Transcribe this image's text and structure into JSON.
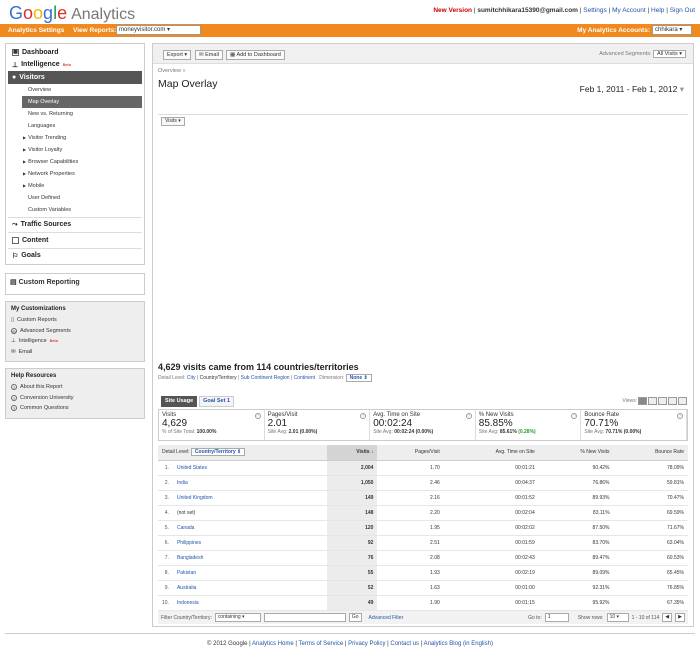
{
  "header": {
    "logo_google": [
      "G",
      "o",
      "o",
      "g",
      "l",
      "e"
    ],
    "logo_analytics": "Analytics",
    "new_version": "New Version",
    "user_email": "sumitchhikara15390@gmail.com",
    "links": [
      "Settings",
      "My Account",
      "Help",
      "Sign Out"
    ]
  },
  "orange_bar": {
    "analytics_settings": "Analytics Settings",
    "view_reports": "View Reports:",
    "site": "moneyvisitor.com",
    "my_accounts": "My Analytics Accounts:",
    "account": "chhikara"
  },
  "sidebar": {
    "dashboard": "Dashboard",
    "intelligence": "Intelligence",
    "beta": "Beta",
    "visitors": "Visitors",
    "visitor_items": [
      {
        "label": "Overview",
        "arrow": false
      },
      {
        "label": "Map Overlay",
        "arrow": false,
        "active": true
      },
      {
        "label": "New vs. Returning",
        "arrow": false
      },
      {
        "label": "Languages",
        "arrow": false
      },
      {
        "label": "Visitor Trending",
        "arrow": true
      },
      {
        "label": "Visitor Loyalty",
        "arrow": true
      },
      {
        "label": "Browser Capabilities",
        "arrow": true
      },
      {
        "label": "Network Properties",
        "arrow": true
      },
      {
        "label": "Mobile",
        "arrow": true
      },
      {
        "label": "User Defined",
        "arrow": false
      },
      {
        "label": "Custom Variables",
        "arrow": false
      }
    ],
    "traffic_sources": "Traffic Sources",
    "content": "Content",
    "goals": "Goals",
    "custom_reporting": "Custom Reporting",
    "my_customizations": {
      "title": "My Customizations",
      "items": [
        "Custom Reports",
        "Advanced Segments",
        "Intelligence",
        "Email"
      ]
    },
    "help_resources": {
      "title": "Help Resources",
      "items": [
        "About this Report",
        "Conversion University",
        "Common Questions"
      ]
    }
  },
  "toolbar": {
    "export": "Export",
    "email": "Email",
    "add_to_dashboard": "Add to Dashboard",
    "advanced_segments": "Advanced Segments:",
    "all_visits": "All Visits"
  },
  "page": {
    "breadcrumb": "Overview »",
    "title": "Map Overlay",
    "date_range": "Feb 1, 2011 - Feb 1, 2012",
    "map_metric": "Visits",
    "headline": "4,629 visits came from 114 countries/territories",
    "detail_level_label": "Detail Level:",
    "detail_links": [
      "City",
      "Country/Territory",
      "Sub Continent Region",
      "Continent"
    ],
    "dimension_label": "Dimension:",
    "dimension_value": "None"
  },
  "tabs": [
    "Site Usage",
    "Goal Set 1"
  ],
  "views_label": "Views:",
  "scorecards": [
    {
      "name": "Visits",
      "value": "4,629",
      "sub_prefix": "% of Site Total:",
      "sub_bold": "100.00%",
      "sub_extra": ""
    },
    {
      "name": "Pages/Visit",
      "value": "2.01",
      "sub_prefix": "Site Avg:",
      "sub_bold": "2.01 (0.00%)",
      "sub_extra": ""
    },
    {
      "name": "Avg. Time on Site",
      "value": "00:02:24",
      "sub_prefix": "Site Avg:",
      "sub_bold": "00:02:24 (0.00%)",
      "sub_extra": ""
    },
    {
      "name": "% New Visits",
      "value": "85.85%",
      "sub_prefix": "Site Avg:",
      "sub_bold": "85.61%",
      "sub_extra": "(0.28%)"
    },
    {
      "name": "Bounce Rate",
      "value": "70.71%",
      "sub_prefix": "Site Avg:",
      "sub_bold": "70.71% (0.00%)",
      "sub_extra": ""
    }
  ],
  "table": {
    "detail_level": "Detail Level:",
    "dimension": "Country/Territory",
    "columns": [
      "Visits",
      "Pages/Visit",
      "Avg. Time on Site",
      "% New Visits",
      "Bounce Rate"
    ],
    "rows": [
      {
        "idx": "1.",
        "name": "United States",
        "link": true,
        "visits": "2,004",
        "ppv": "1.70",
        "time": "00:01:21",
        "new": "90.42%",
        "bounce": "78.09%"
      },
      {
        "idx": "2.",
        "name": "India",
        "link": true,
        "visits": "1,050",
        "ppv": "2.46",
        "time": "00:04:37",
        "new": "76.86%",
        "bounce": "59.81%"
      },
      {
        "idx": "3.",
        "name": "United Kingdom",
        "link": true,
        "visits": "149",
        "ppv": "2.16",
        "time": "00:01:52",
        "new": "89.93%",
        "bounce": "70.47%"
      },
      {
        "idx": "4.",
        "name": "(not set)",
        "link": false,
        "visits": "148",
        "ppv": "2.20",
        "time": "00:02:04",
        "new": "83.11%",
        "bounce": "69.59%"
      },
      {
        "idx": "5.",
        "name": "Canada",
        "link": true,
        "visits": "120",
        "ppv": "1.95",
        "time": "00:02:02",
        "new": "87.50%",
        "bounce": "71.67%"
      },
      {
        "idx": "6.",
        "name": "Philippines",
        "link": true,
        "visits": "92",
        "ppv": "2.51",
        "time": "00:01:59",
        "new": "83.70%",
        "bounce": "63.04%"
      },
      {
        "idx": "7.",
        "name": "Bangladesh",
        "link": true,
        "visits": "76",
        "ppv": "2.08",
        "time": "00:02:43",
        "new": "89.47%",
        "bounce": "60.53%"
      },
      {
        "idx": "8.",
        "name": "Pakistan",
        "link": true,
        "visits": "55",
        "ppv": "1.93",
        "time": "00:02:19",
        "new": "89.09%",
        "bounce": "65.45%"
      },
      {
        "idx": "9.",
        "name": "Australia",
        "link": true,
        "visits": "52",
        "ppv": "1.63",
        "time": "00:01:00",
        "new": "92.31%",
        "bounce": "76.85%"
      },
      {
        "idx": "10.",
        "name": "Indonesia",
        "link": true,
        "visits": "49",
        "ppv": "1.90",
        "time": "00:01:15",
        "new": "95.92%",
        "bounce": "67.35%"
      }
    ]
  },
  "filter": {
    "label": "Filter Country/Territory:",
    "mode": "containing",
    "go": "Go",
    "advanced": "Advanced Filter",
    "goto_label": "Go to:",
    "goto_value": "1",
    "show_rows_label": "Show rows:",
    "show_rows": "10",
    "range": "1 - 10 of 114"
  },
  "footer": {
    "copyright": "© 2012 Google",
    "links": [
      "Analytics Home",
      "Terms of Service",
      "Privacy Policy",
      "Contact us",
      "Analytics Blog (in English)"
    ]
  },
  "colors": {
    "orange_bar": "#f08a1e",
    "link": "#2255aa",
    "new_version": "#cc0000"
  }
}
